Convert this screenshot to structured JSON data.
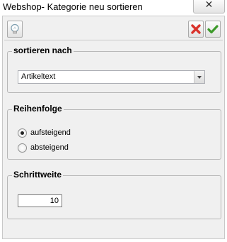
{
  "window": {
    "title": "Webshop- Kategorie neu sortieren",
    "close_symbol": "✕"
  },
  "toolbar": {
    "help_icon": "lightbulb-icon",
    "cancel_icon": "red-x-icon",
    "ok_icon": "green-check-icon"
  },
  "sort_by": {
    "title": "sortieren nach",
    "selected": "Artikeltext"
  },
  "order": {
    "title": "Reihenfolge",
    "options": [
      {
        "label": "aufsteigend",
        "checked": true
      },
      {
        "label": "absteigend",
        "checked": false
      }
    ]
  },
  "step": {
    "title": "Schrittweite",
    "value": "10"
  },
  "colors": {
    "cancel": "#d9322b",
    "ok": "#3d9a2a",
    "face": "#f0f0f0"
  }
}
